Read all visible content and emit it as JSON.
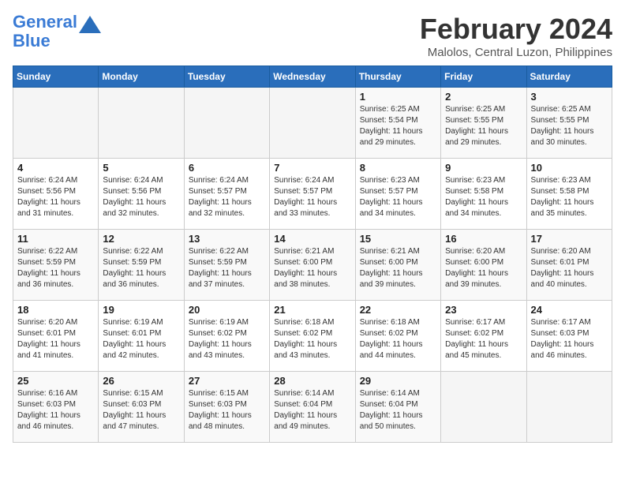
{
  "header": {
    "logo_line1": "General",
    "logo_line2": "Blue",
    "month_year": "February 2024",
    "location": "Malolos, Central Luzon, Philippines"
  },
  "days_of_week": [
    "Sunday",
    "Monday",
    "Tuesday",
    "Wednesday",
    "Thursday",
    "Friday",
    "Saturday"
  ],
  "weeks": [
    [
      {
        "day": "",
        "info": ""
      },
      {
        "day": "",
        "info": ""
      },
      {
        "day": "",
        "info": ""
      },
      {
        "day": "",
        "info": ""
      },
      {
        "day": "1",
        "info": "Sunrise: 6:25 AM\nSunset: 5:54 PM\nDaylight: 11 hours\nand 29 minutes."
      },
      {
        "day": "2",
        "info": "Sunrise: 6:25 AM\nSunset: 5:55 PM\nDaylight: 11 hours\nand 29 minutes."
      },
      {
        "day": "3",
        "info": "Sunrise: 6:25 AM\nSunset: 5:55 PM\nDaylight: 11 hours\nand 30 minutes."
      }
    ],
    [
      {
        "day": "4",
        "info": "Sunrise: 6:24 AM\nSunset: 5:56 PM\nDaylight: 11 hours\nand 31 minutes."
      },
      {
        "day": "5",
        "info": "Sunrise: 6:24 AM\nSunset: 5:56 PM\nDaylight: 11 hours\nand 32 minutes."
      },
      {
        "day": "6",
        "info": "Sunrise: 6:24 AM\nSunset: 5:57 PM\nDaylight: 11 hours\nand 32 minutes."
      },
      {
        "day": "7",
        "info": "Sunrise: 6:24 AM\nSunset: 5:57 PM\nDaylight: 11 hours\nand 33 minutes."
      },
      {
        "day": "8",
        "info": "Sunrise: 6:23 AM\nSunset: 5:57 PM\nDaylight: 11 hours\nand 34 minutes."
      },
      {
        "day": "9",
        "info": "Sunrise: 6:23 AM\nSunset: 5:58 PM\nDaylight: 11 hours\nand 34 minutes."
      },
      {
        "day": "10",
        "info": "Sunrise: 6:23 AM\nSunset: 5:58 PM\nDaylight: 11 hours\nand 35 minutes."
      }
    ],
    [
      {
        "day": "11",
        "info": "Sunrise: 6:22 AM\nSunset: 5:59 PM\nDaylight: 11 hours\nand 36 minutes."
      },
      {
        "day": "12",
        "info": "Sunrise: 6:22 AM\nSunset: 5:59 PM\nDaylight: 11 hours\nand 36 minutes."
      },
      {
        "day": "13",
        "info": "Sunrise: 6:22 AM\nSunset: 5:59 PM\nDaylight: 11 hours\nand 37 minutes."
      },
      {
        "day": "14",
        "info": "Sunrise: 6:21 AM\nSunset: 6:00 PM\nDaylight: 11 hours\nand 38 minutes."
      },
      {
        "day": "15",
        "info": "Sunrise: 6:21 AM\nSunset: 6:00 PM\nDaylight: 11 hours\nand 39 minutes."
      },
      {
        "day": "16",
        "info": "Sunrise: 6:20 AM\nSunset: 6:00 PM\nDaylight: 11 hours\nand 39 minutes."
      },
      {
        "day": "17",
        "info": "Sunrise: 6:20 AM\nSunset: 6:01 PM\nDaylight: 11 hours\nand 40 minutes."
      }
    ],
    [
      {
        "day": "18",
        "info": "Sunrise: 6:20 AM\nSunset: 6:01 PM\nDaylight: 11 hours\nand 41 minutes."
      },
      {
        "day": "19",
        "info": "Sunrise: 6:19 AM\nSunset: 6:01 PM\nDaylight: 11 hours\nand 42 minutes."
      },
      {
        "day": "20",
        "info": "Sunrise: 6:19 AM\nSunset: 6:02 PM\nDaylight: 11 hours\nand 43 minutes."
      },
      {
        "day": "21",
        "info": "Sunrise: 6:18 AM\nSunset: 6:02 PM\nDaylight: 11 hours\nand 43 minutes."
      },
      {
        "day": "22",
        "info": "Sunrise: 6:18 AM\nSunset: 6:02 PM\nDaylight: 11 hours\nand 44 minutes."
      },
      {
        "day": "23",
        "info": "Sunrise: 6:17 AM\nSunset: 6:02 PM\nDaylight: 11 hours\nand 45 minutes."
      },
      {
        "day": "24",
        "info": "Sunrise: 6:17 AM\nSunset: 6:03 PM\nDaylight: 11 hours\nand 46 minutes."
      }
    ],
    [
      {
        "day": "25",
        "info": "Sunrise: 6:16 AM\nSunset: 6:03 PM\nDaylight: 11 hours\nand 46 minutes."
      },
      {
        "day": "26",
        "info": "Sunrise: 6:15 AM\nSunset: 6:03 PM\nDaylight: 11 hours\nand 47 minutes."
      },
      {
        "day": "27",
        "info": "Sunrise: 6:15 AM\nSunset: 6:03 PM\nDaylight: 11 hours\nand 48 minutes."
      },
      {
        "day": "28",
        "info": "Sunrise: 6:14 AM\nSunset: 6:04 PM\nDaylight: 11 hours\nand 49 minutes."
      },
      {
        "day": "29",
        "info": "Sunrise: 6:14 AM\nSunset: 6:04 PM\nDaylight: 11 hours\nand 50 minutes."
      },
      {
        "day": "",
        "info": ""
      },
      {
        "day": "",
        "info": ""
      }
    ]
  ]
}
